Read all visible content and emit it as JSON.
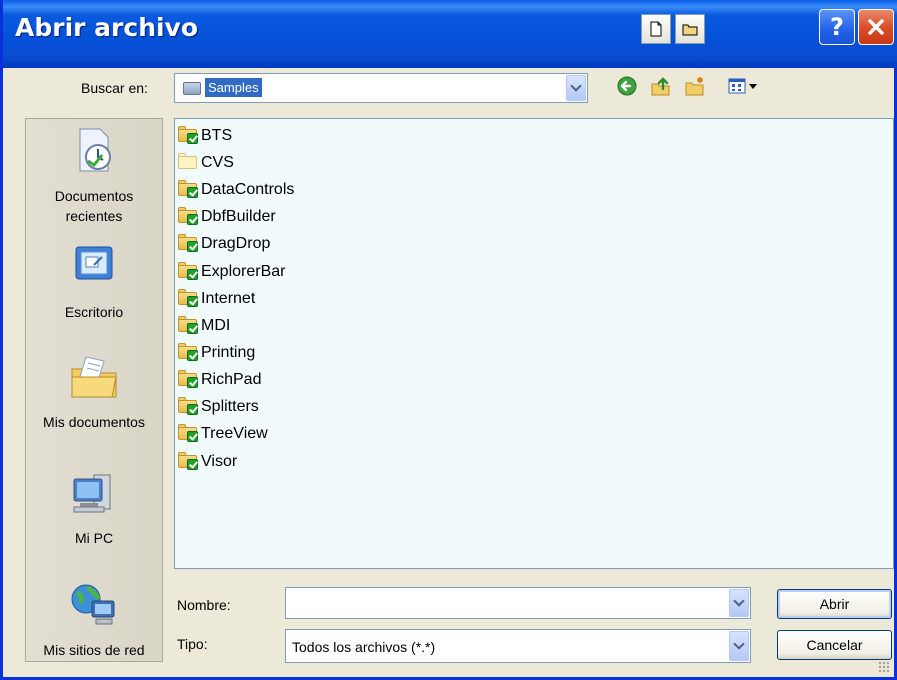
{
  "window": {
    "title": "Abrir archivo"
  },
  "lookin": {
    "label": "Buscar en:",
    "value": "Samples"
  },
  "places": [
    {
      "label": "Documentos recientes",
      "icon": "recent-documents-icon"
    },
    {
      "label": "Escritorio",
      "icon": "desktop-icon"
    },
    {
      "label": "Mis documentos",
      "icon": "my-documents-icon"
    },
    {
      "label": "Mi PC",
      "icon": "my-computer-icon"
    },
    {
      "label": "Mis sitios de red",
      "icon": "network-places-icon"
    }
  ],
  "files": [
    {
      "name": "BTS",
      "shared": true
    },
    {
      "name": "CVS",
      "shared": false
    },
    {
      "name": "DataControls",
      "shared": true
    },
    {
      "name": "DbfBuilder",
      "shared": true
    },
    {
      "name": "DragDrop",
      "shared": true
    },
    {
      "name": "ExplorerBar",
      "shared": true
    },
    {
      "name": "Internet",
      "shared": true
    },
    {
      "name": "MDI",
      "shared": true
    },
    {
      "name": "Printing",
      "shared": true
    },
    {
      "name": "RichPad",
      "shared": true
    },
    {
      "name": "Splitters",
      "shared": true
    },
    {
      "name": "TreeView",
      "shared": true
    },
    {
      "name": "Visor",
      "shared": true
    }
  ],
  "filename": {
    "label": "Nombre:",
    "value": ""
  },
  "filetype": {
    "label": "Tipo:",
    "value": "Todos los archivos (*.*)"
  },
  "buttons": {
    "open": "Abrir",
    "cancel": "Cancelar"
  },
  "colors": {
    "title_bar": "#0A5AE0",
    "selection": "#316AC5",
    "list_bg": "#F1FBFB",
    "dialog_bg": "#ECE9D8"
  }
}
